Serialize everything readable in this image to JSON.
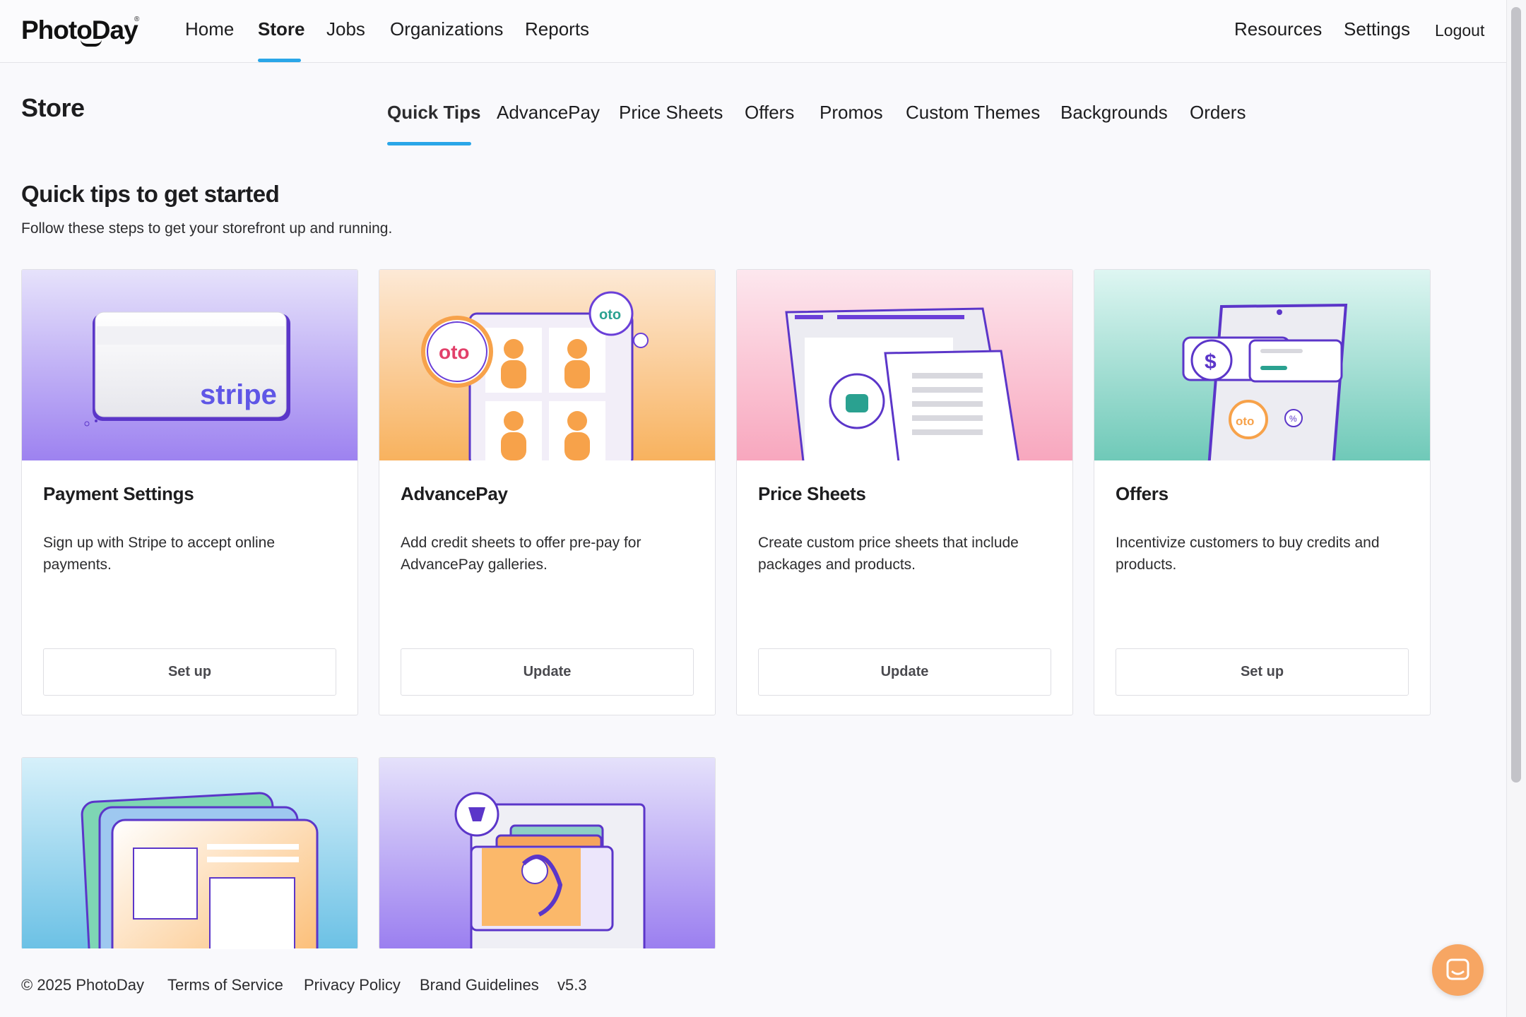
{
  "brand": {
    "name": "PhotoDay",
    "reg": "®"
  },
  "nav": {
    "items": [
      {
        "label": "Home"
      },
      {
        "label": "Store"
      },
      {
        "label": "Jobs"
      },
      {
        "label": "Organizations"
      },
      {
        "label": "Reports"
      }
    ],
    "active": "Store",
    "right": [
      {
        "label": "Resources"
      },
      {
        "label": "Settings"
      },
      {
        "label": "Logout"
      }
    ]
  },
  "page": {
    "title": "Store"
  },
  "subtabs": {
    "items": [
      {
        "label": "Quick Tips"
      },
      {
        "label": "AdvancePay"
      },
      {
        "label": "Price Sheets"
      },
      {
        "label": "Offers"
      },
      {
        "label": "Promos"
      },
      {
        "label": "Custom Themes"
      },
      {
        "label": "Backgrounds"
      },
      {
        "label": "Orders"
      }
    ],
    "active": "Quick Tips"
  },
  "section": {
    "title": "Quick tips to get started",
    "description": "Follow these steps to get your storefront up and running."
  },
  "cards": [
    {
      "title": "Payment Settings",
      "description": "Sign up with Stripe to accept online payments.",
      "button": "Set up",
      "art_text": "stripe"
    },
    {
      "title": "AdvancePay",
      "description": "Add credit sheets to offer pre-pay for AdvancePay galleries.",
      "button": "Update",
      "art_text": "oto"
    },
    {
      "title": "Price Sheets",
      "description": "Create custom price sheets that include packages and products.",
      "button": "Update"
    },
    {
      "title": "Offers",
      "description": "Incentivize customers to buy credits and products.",
      "button": "Set up",
      "art_text": "oto"
    }
  ],
  "footer": {
    "copyright": "© 2025 PhotoDay",
    "links": [
      {
        "label": "Terms of Service"
      },
      {
        "label": "Privacy Policy"
      },
      {
        "label": "Brand Guidelines"
      }
    ],
    "version": "v5.3"
  },
  "colors": {
    "accent": "#2aa6e8",
    "purple": "#6a3fd8",
    "orange": "#f7a663",
    "chat": "#f7a663"
  },
  "icons": [
    "chat-icon",
    "paint-bucket-icon",
    "shopping-bag-icon",
    "dollar-icon",
    "percent-icon"
  ]
}
